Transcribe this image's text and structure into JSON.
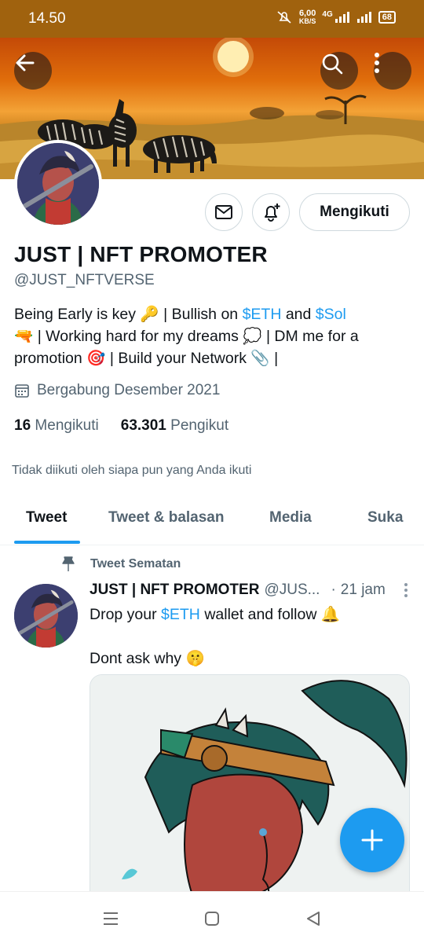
{
  "status_bar": {
    "time": "14.50",
    "speed_value": "6,00",
    "speed_unit": "KB/S",
    "network": "4G",
    "battery": "68"
  },
  "header": {
    "back_icon": "arrow-left-icon",
    "search_icon": "search-icon",
    "more_icon": "more-vertical-icon"
  },
  "profile": {
    "display_name": "JUST | NFT PROMOTER",
    "handle": "@JUST_NFTVERSE",
    "bio": {
      "part1": "Being Early is key ",
      "key_emoji": "🔑",
      "part2": " | Bullish on ",
      "eth": "$ETH",
      "and": " and ",
      "sol": "$Sol",
      "gun_emoji": "🔫",
      "part3": " | Working hard for my dreams ",
      "cloud_emoji": "💭",
      "part4": " | DM me for a promotion ",
      "target_emoji": "🎯",
      "part5": " | Build your Network ",
      "clip_emoji": "📎",
      "part6": " |"
    },
    "joined": "Bergabung Desember 2021",
    "following_count": "16",
    "following_label": "Mengikuti",
    "followers_count": "63.301",
    "followers_label": "Pengikut",
    "not_followed_text": "Tidak diikuti oleh siapa pun yang Anda ikuti",
    "follow_button_label": "Mengikuti",
    "message_icon": "envelope-icon",
    "notify_icon": "bell-plus-icon"
  },
  "tabs": [
    {
      "label": "Tweet",
      "active": true
    },
    {
      "label": "Tweet & balasan",
      "active": false
    },
    {
      "label": "Media",
      "active": false
    },
    {
      "label": "Suka",
      "active": false
    }
  ],
  "tweet": {
    "pinned_label": "Tweet Sematan",
    "author_name": "JUST | NFT PROMOTER",
    "author_handle": "@JUS...",
    "separator": "·",
    "time": "21 jam",
    "text_prefix": "Drop your ",
    "text_eth": "$ETH",
    "text_suffix": " wallet and follow ",
    "bell_emoji": "🔔",
    "text_line2": "Dont ask why ",
    "shush_emoji": "🤫"
  },
  "fab": {
    "icon": "plus-icon"
  },
  "nav": {
    "menu_icon": "recent-apps-icon",
    "home_icon": "home-icon",
    "back_icon": "back-triangle-icon"
  },
  "colors": {
    "accent": "#1d9bf0",
    "text": "#0f1419",
    "muted": "#536471",
    "status_bar": "#a0620e"
  }
}
